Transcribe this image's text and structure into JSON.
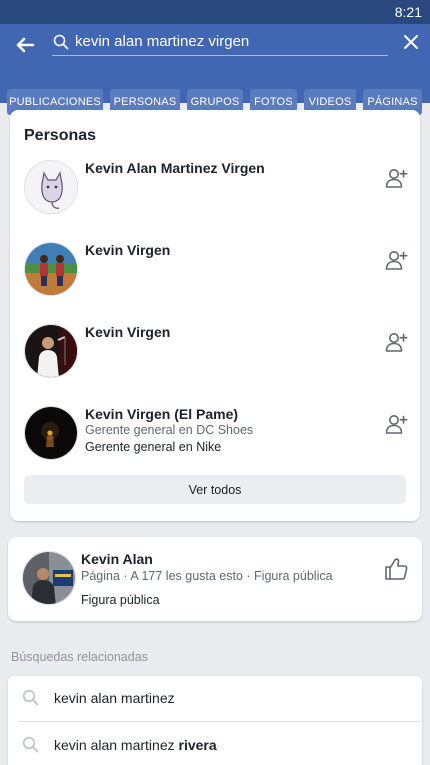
{
  "status_bar": {
    "time": "8:21"
  },
  "search": {
    "query": "kevin alan martinez virgen"
  },
  "filters": [
    "PUBLICACIONES",
    "PERSONAS",
    "GRUPOS",
    "FOTOS",
    "VIDEOS",
    "PÁGINAS"
  ],
  "people": {
    "title": "Personas",
    "results": [
      {
        "name": "Kevin Alan Martinez Virgen",
        "line1": "",
        "line2": "",
        "avatar_icon": "cat-drawing-avatar"
      },
      {
        "name": "Kevin Virgen",
        "line1": "",
        "line2": "",
        "avatar_icon": "two-people-avatar"
      },
      {
        "name": "Kevin Virgen",
        "line1": "",
        "line2": "",
        "avatar_icon": "singer-avatar"
      },
      {
        "name": "Kevin Virgen (El Pame)",
        "line1": "Gerente general en DC Shoes",
        "line2": "Gerente general en Nike",
        "avatar_icon": "dark-stage-avatar"
      }
    ],
    "see_all": "Ver todos"
  },
  "page_result": {
    "name": "Kevin Alan",
    "meta": "Página · A 177 les gusta esto · Figura pública",
    "category": "Figura pública"
  },
  "related": {
    "title": "Búsquedas relacionadas",
    "items": [
      {
        "text": "kevin alan martinez",
        "bold": ""
      },
      {
        "text": "kevin alan martinez ",
        "bold": "rivera"
      }
    ]
  },
  "colors": {
    "brand": "#4267b2",
    "statusbar": "#29487d",
    "chip": "#5b7bbf",
    "background": "#e9ebee"
  }
}
